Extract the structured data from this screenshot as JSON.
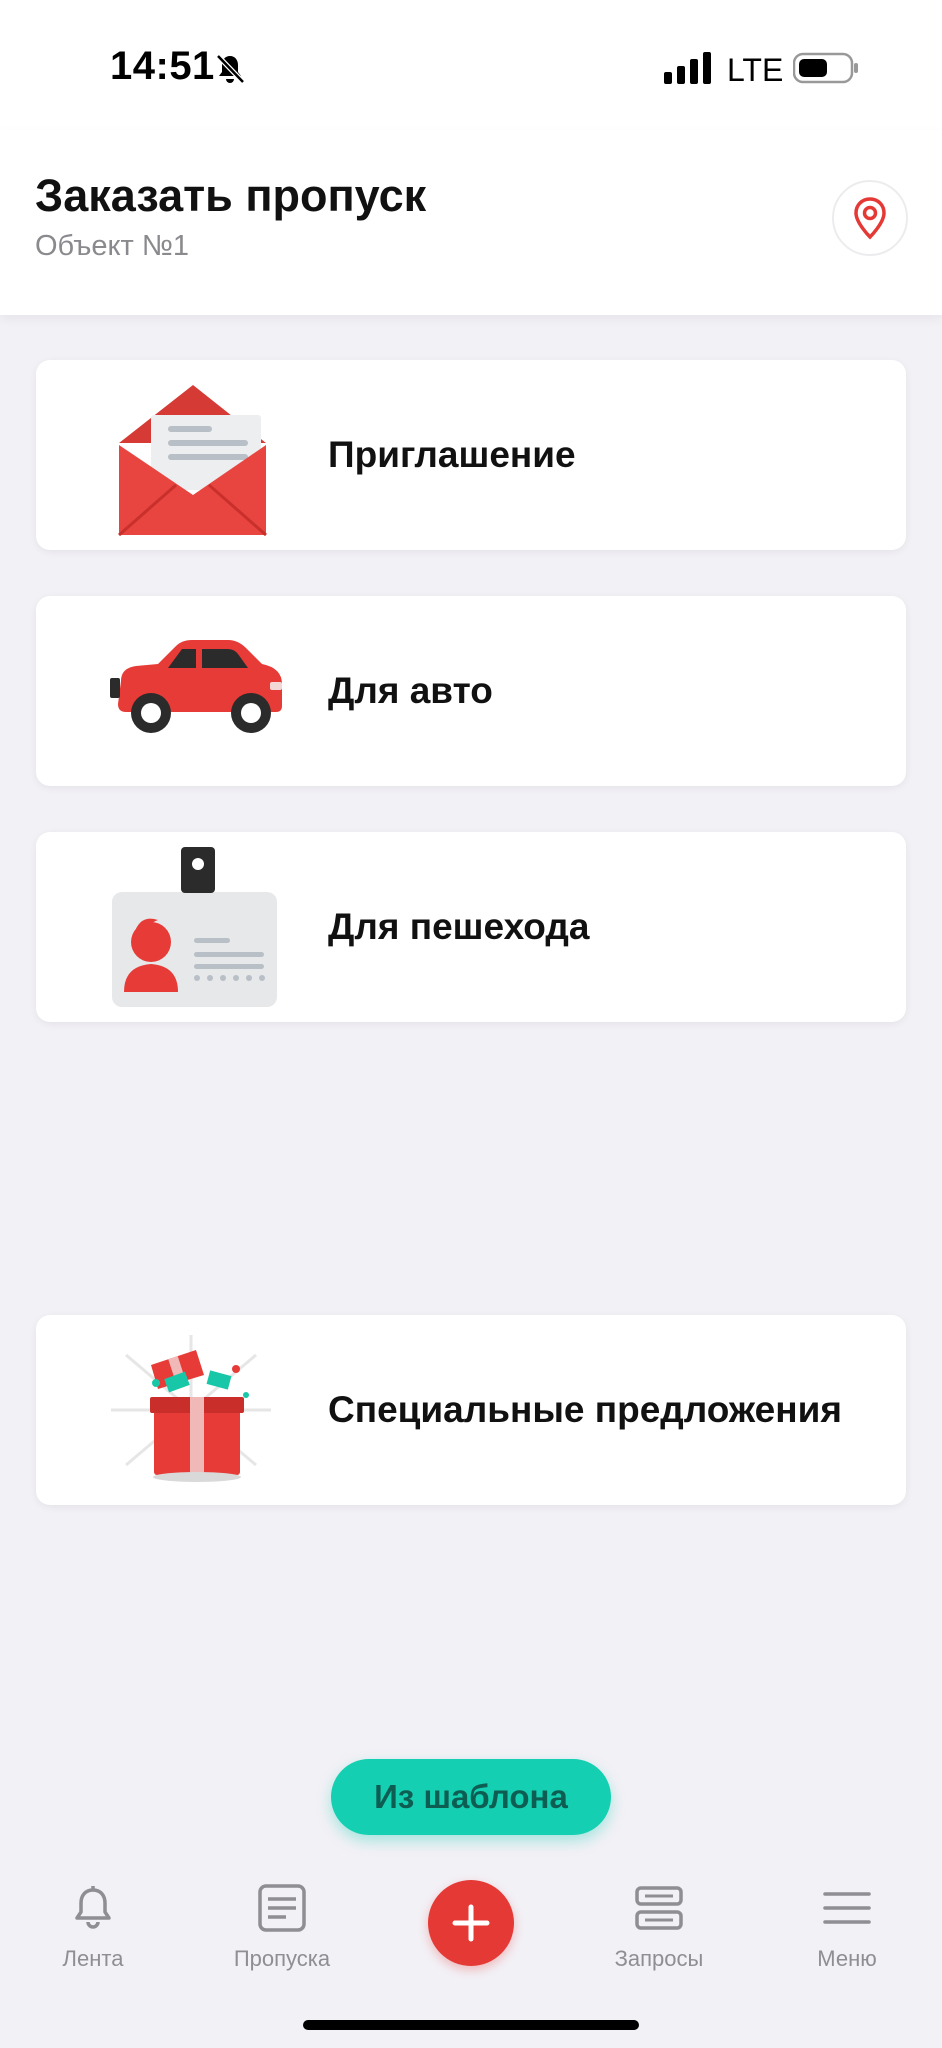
{
  "status_bar": {
    "time": "14:51",
    "network": "LTE"
  },
  "header": {
    "title": "Заказать пропуск",
    "subtitle": "Объект №1"
  },
  "options": [
    {
      "label": "Приглашение",
      "icon": "envelope-icon"
    },
    {
      "label": "Для авто",
      "icon": "car-icon"
    },
    {
      "label": "Для пешехода",
      "icon": "id-badge-icon"
    },
    {
      "label": "Специальные предложения",
      "icon": "gift-icon"
    }
  ],
  "template_button": {
    "label": "Из шаблона"
  },
  "tab_bar": {
    "tabs": [
      {
        "label": "Лента",
        "icon": "bell-icon"
      },
      {
        "label": "Пропуска",
        "icon": "document-icon"
      },
      {
        "label": "Запросы",
        "icon": "stack-icon"
      },
      {
        "label": "Меню",
        "icon": "menu-icon"
      }
    ],
    "fab_icon": "plus-icon"
  },
  "colors": {
    "accent_red": "#e53935",
    "accent_teal": "#14cfb1",
    "background": "#f2f1f6"
  }
}
